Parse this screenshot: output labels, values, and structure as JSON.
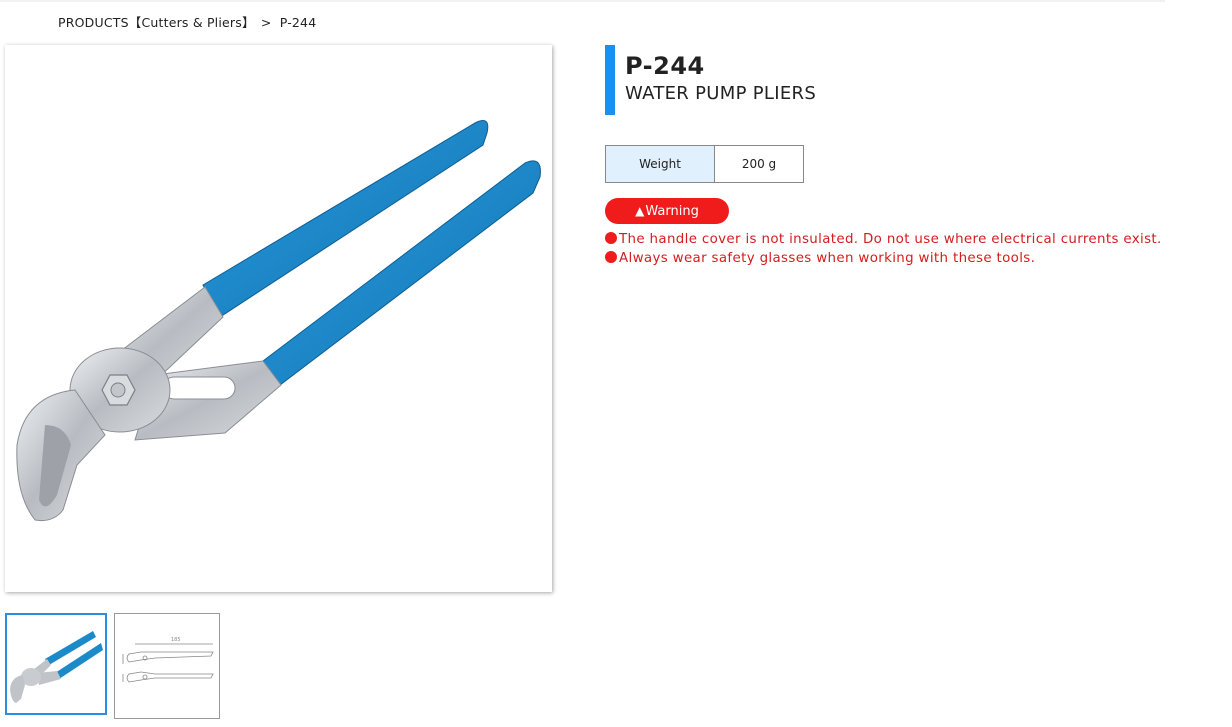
{
  "breadcrumb": {
    "root": "PRODUCTS",
    "category": "【Cutters & Pliers】",
    "separator": ">",
    "current": "P-244"
  },
  "product": {
    "code": "P-244",
    "name": "WATER PUMP PLIERS"
  },
  "specs": {
    "weight_label": "Weight",
    "weight_value": "200 g"
  },
  "warning": {
    "badge_icon": "warning-triangle-icon",
    "badge_label": "Warning",
    "items": [
      "The handle cover is not insulated. Do not use where electrical currents exist.",
      "Always wear safety glasses when working with these tools."
    ]
  },
  "thumbnails": [
    {
      "name": "product-photo"
    },
    {
      "name": "dimension-drawing"
    }
  ],
  "colors": {
    "accent_blue": "#1a90f0",
    "warning_red": "#f01c1c",
    "handle_blue": "#1c8ac8",
    "spec_label_bg": "#e0f0fc"
  }
}
